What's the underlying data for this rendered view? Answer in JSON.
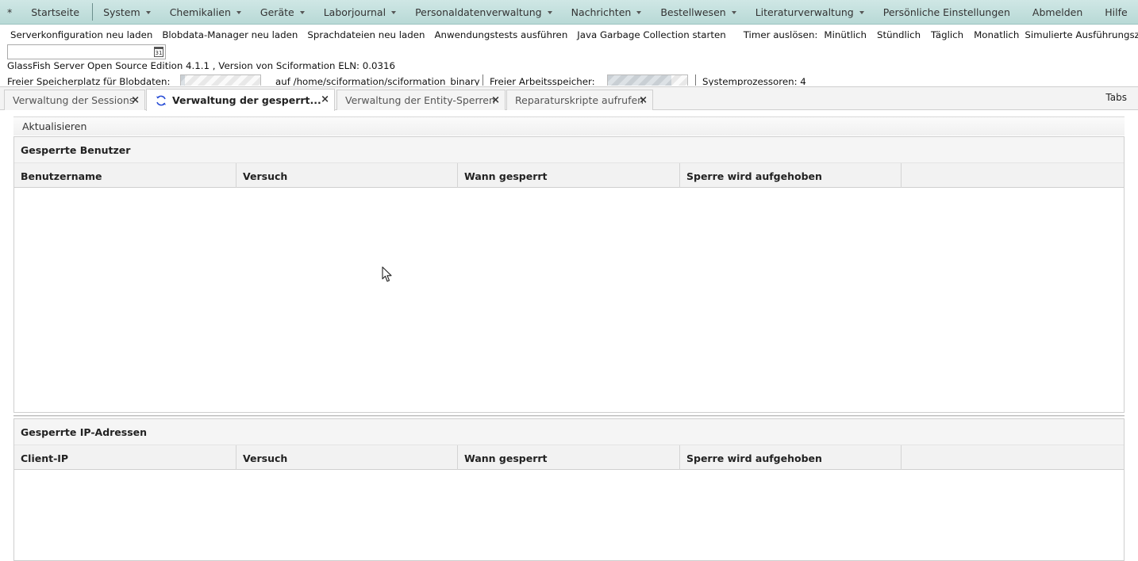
{
  "menu": {
    "star": "*",
    "home": "Startseite",
    "items": [
      {
        "label": "System",
        "dropdown": true
      },
      {
        "label": "Chemikalien",
        "dropdown": true
      },
      {
        "label": "Geräte",
        "dropdown": true
      },
      {
        "label": "Laborjournal",
        "dropdown": true
      },
      {
        "label": "Personaldatenverwaltung",
        "dropdown": true
      },
      {
        "label": "Nachrichten",
        "dropdown": true
      },
      {
        "label": "Bestellwesen",
        "dropdown": true
      },
      {
        "label": "Literaturverwaltung",
        "dropdown": true
      },
      {
        "label": "Persönliche Einstellungen",
        "dropdown": false
      },
      {
        "label": "Abmelden",
        "dropdown": false
      },
      {
        "label": "Hilfe",
        "dropdown": false
      }
    ]
  },
  "toolbar": {
    "actions": [
      "Serverkonfiguration neu laden",
      "Blobdata-Manager neu laden",
      "Sprachdateien neu laden",
      "Anwendungstests ausführen",
      "Java Garbage Collection starten"
    ],
    "timer_label": "Timer auslösen:",
    "timer_options": [
      "Minütlich",
      "Stündlich",
      "Täglich",
      "Monatlich"
    ],
    "simulated_time_label": "Simulierte Ausführungszeit:",
    "simulated_time_value": "",
    "calendar_icon_text": "31"
  },
  "server_info": "GlassFish Server Open Source Edition 4.1.1 , Version von Sciformation ELN: 0.0316",
  "stats": {
    "blob_label": "Freier Speicherplatz für Blobdaten:",
    "blob_path": "auf /home/sciformation/sciformation_binary",
    "memory_label": "Freier Arbeitsspeicher:",
    "cpu_label": "Systemprozessoren: 4",
    "blob_fill_fraction": 0.05,
    "memory_fill_fraction": 0.8
  },
  "tabs": [
    {
      "label": "Verwaltung der Sessions",
      "active": false
    },
    {
      "label": "Verwaltung der gesperrt...",
      "active": true
    },
    {
      "label": "Verwaltung der Entity-Sperren",
      "active": false
    },
    {
      "label": "Reparaturskripte aufrufen",
      "active": false
    }
  ],
  "tab_close": "×",
  "tabs_menu_label": "Tabs",
  "refresh_label": "Aktualisieren",
  "locked_users": {
    "title": "Gesperrte Benutzer",
    "columns": [
      "Benutzername",
      "Versuch",
      "Wann gesperrt",
      "Sperre wird aufgehoben",
      ""
    ],
    "rows": []
  },
  "locked_ips": {
    "title": "Gesperrte IP-Adressen",
    "columns": [
      "Client-IP",
      "Versuch",
      "Wann gesperrt",
      "Sperre wird aufgehoben",
      ""
    ],
    "rows": []
  }
}
